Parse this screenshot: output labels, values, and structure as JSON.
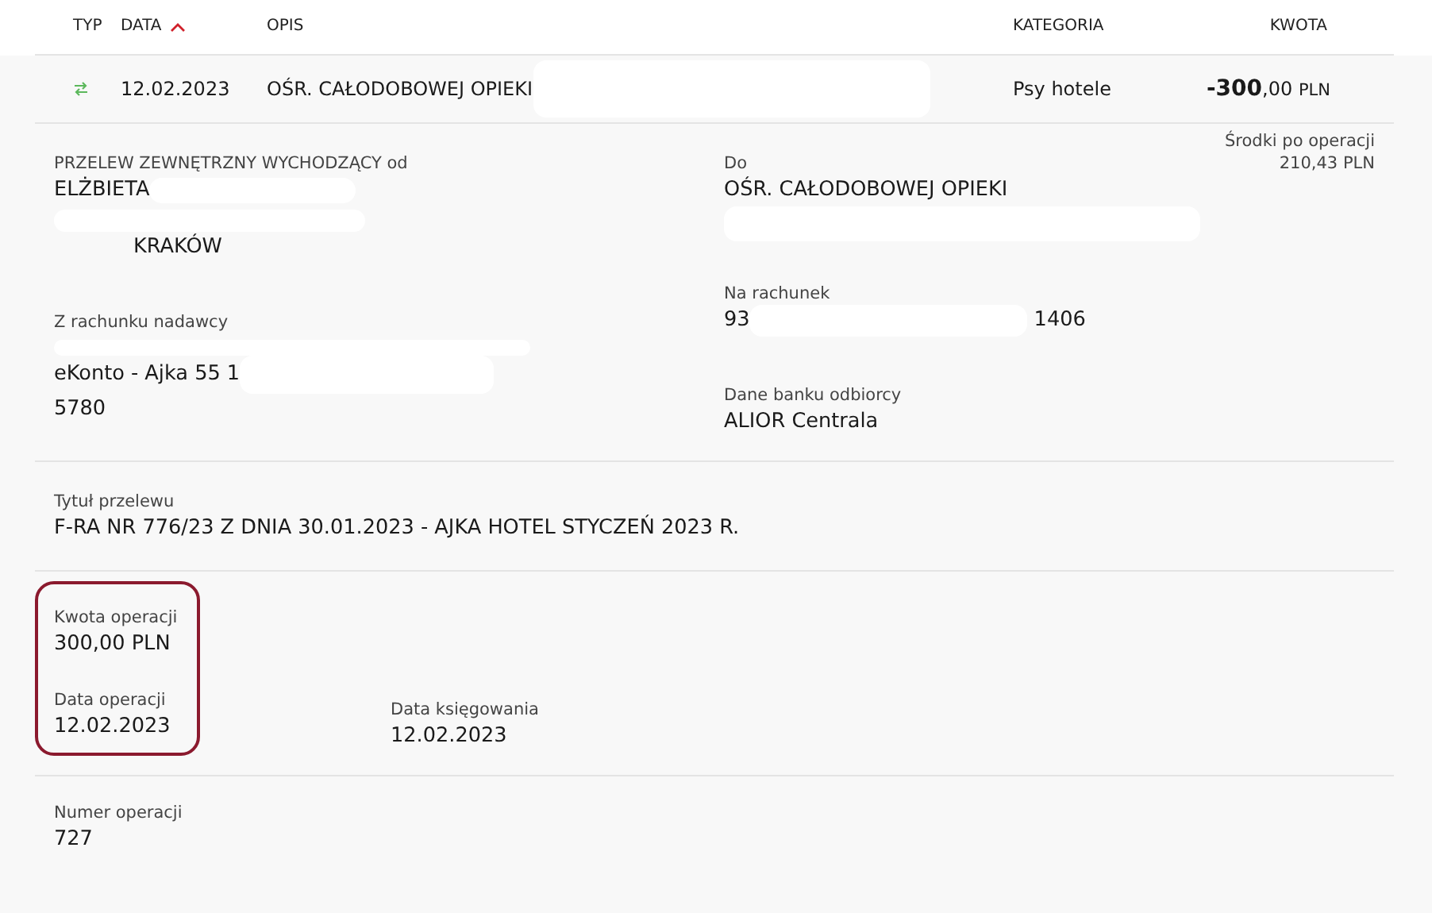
{
  "table": {
    "columns": [
      {
        "label": "TYP",
        "sorted": false
      },
      {
        "label": "DATA",
        "sorted": true
      },
      {
        "label": "OPIS",
        "sorted": false
      },
      {
        "label": "KATEGORIA",
        "sorted": false
      },
      {
        "label": "KWOTA",
        "sorted": false
      }
    ],
    "row": {
      "date": "12.02.2023",
      "description": "OŚR. CAŁODOBOWEJ OPIEKI",
      "category": "Psy hotele",
      "amount_main": "-300",
      "amount_fraction": ",00",
      "currency": "PLN"
    }
  },
  "details": {
    "sender": {
      "label": "PRZELEW ZEWNĘTRZNY WYCHODZĄCY od",
      "name": "ELŻBIETA",
      "city": "KRAKÓW"
    },
    "sender_account": {
      "label": "Z rachunku nadawcy",
      "start": "eKonto - Ajka 55 1",
      "end": "5780"
    },
    "recipient": {
      "label": "Do",
      "value": "OŚR. CAŁODOBOWEJ OPIEKI"
    },
    "recipient_account": {
      "label": "Na rachunek",
      "start": "93",
      "end": "1406"
    },
    "bank": {
      "label": "Dane banku odbiorcy",
      "value": "ALIOR Centrala"
    },
    "balance": {
      "label": "Środki po operacji",
      "value": "210,43 PLN"
    },
    "title": {
      "label": "Tytuł przelewu",
      "value": "F-RA NR 776/23 Z DNIA 30.01.2023 - AJKA HOTEL STYCZEŃ 2023 R."
    },
    "amount": {
      "label": "Kwota operacji",
      "value": "300,00 PLN",
      "highlighted": true
    },
    "dates": [
      {
        "label": "Data operacji",
        "value": "12.02.2023",
        "highlighted": true
      },
      {
        "label": "Data księgowania",
        "value": "12.02.2023",
        "highlighted": false
      }
    ],
    "number": {
      "label": "Numer operacji",
      "value": "727"
    }
  }
}
